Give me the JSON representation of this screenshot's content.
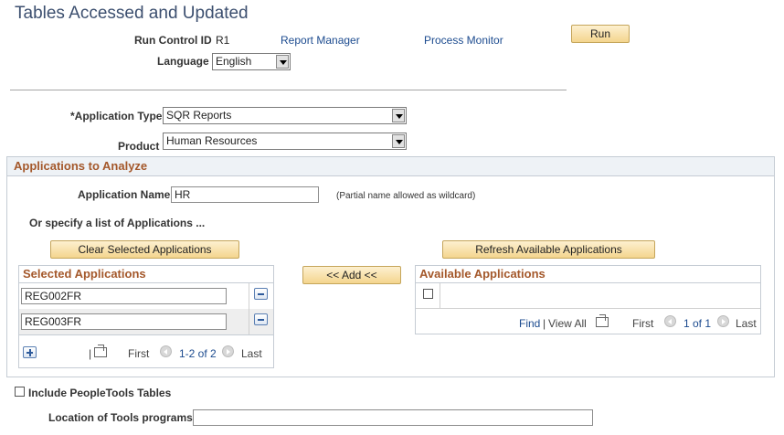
{
  "page": {
    "title": "Tables Accessed and Updated"
  },
  "run_control": {
    "label": "Run Control ID",
    "value": "R1",
    "report_manager": "Report Manager",
    "process_monitor": "Process Monitor",
    "run_button": "Run",
    "language_label": "Language",
    "language_value": "English"
  },
  "application_type": {
    "label": "*Application Type",
    "value": "SQR Reports"
  },
  "product": {
    "label": "Product",
    "value": "Human Resources"
  },
  "analyze": {
    "section_title": "Applications to Analyze",
    "app_name_label": "Application Name",
    "app_name_value": "HR",
    "app_name_hint": "(Partial name allowed as wildcard)",
    "or_specify": "Or specify a list of Applications ...",
    "clear_button": "Clear Selected Applications",
    "refresh_button": "Refresh Available Applications",
    "add_button": "<< Add <<",
    "selected": {
      "title": "Selected Applications",
      "rows": [
        "REG002FR",
        "REG003FR"
      ],
      "nav_first": "First",
      "nav_range": "1-2 of 2",
      "nav_last": "Last",
      "pipe": "|"
    },
    "available": {
      "title": "Available Applications",
      "find": "Find",
      "view_all": "View All",
      "separator": "|",
      "nav_first": "First",
      "nav_range": "1 of 1",
      "nav_last": "Last"
    }
  },
  "tools": {
    "include_label": "Include PeopleTools Tables",
    "location_label": "Location of Tools programs",
    "location_value": ""
  }
}
